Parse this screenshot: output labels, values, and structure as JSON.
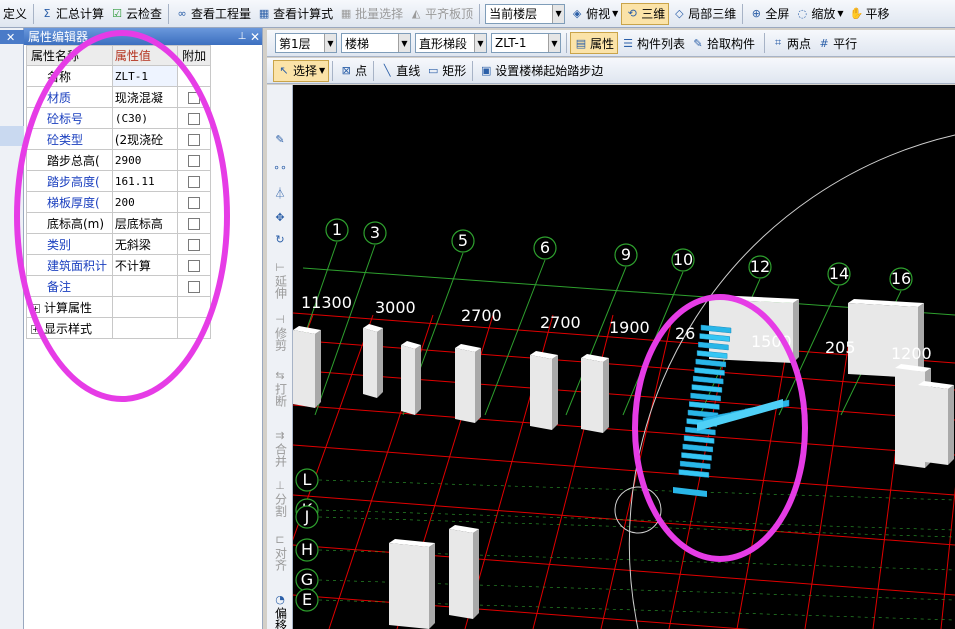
{
  "toolbar_top": {
    "define": "定义",
    "summary_calc": "汇总计算",
    "cloud_check": "云检查",
    "view_quantity": "查看工程量",
    "view_formula": "查看计算式",
    "batch_select": "批量选择",
    "flush_slab_top": "平齐板顶",
    "floor_select": "当前楼层",
    "top_view": "俯视",
    "three_d": "三维",
    "local_3d": "局部三维",
    "full_screen": "全屏",
    "zoom": "缩放",
    "pan": "平移"
  },
  "property_panel": {
    "title": "属性编辑器",
    "columns": [
      "属性名称",
      "属性值",
      "附加"
    ],
    "rows": [
      {
        "name": "名称",
        "value": "ZLT-1",
        "checkbox": false,
        "blue": false,
        "value_cjk": false
      },
      {
        "name": "材质",
        "value": "现浇混凝",
        "checkbox": true,
        "blue": true,
        "value_cjk": true
      },
      {
        "name": "砼标号",
        "value": "(C30)",
        "checkbox": true,
        "blue": true,
        "value_cjk": false
      },
      {
        "name": "砼类型",
        "value": "(2现浇砼",
        "checkbox": true,
        "blue": true,
        "value_cjk": true
      },
      {
        "name": "踏步总高(",
        "value": "2900",
        "checkbox": true,
        "blue": false,
        "value_cjk": false
      },
      {
        "name": "踏步高度(",
        "value": "161.11",
        "checkbox": true,
        "blue": true,
        "value_cjk": false
      },
      {
        "name": "梯板厚度(",
        "value": "200",
        "checkbox": true,
        "blue": true,
        "value_cjk": false
      },
      {
        "name": "底标高(m)",
        "value": "层底标高",
        "checkbox": true,
        "blue": false,
        "value_cjk": true
      },
      {
        "name": "类别",
        "value": "无斜梁",
        "checkbox": true,
        "blue": true,
        "value_cjk": true
      },
      {
        "name": "建筑面积计",
        "value": "不计算",
        "checkbox": true,
        "blue": true,
        "value_cjk": true
      },
      {
        "name": "备注",
        "value": "",
        "checkbox": true,
        "blue": true,
        "value_cjk": false
      }
    ],
    "groups": [
      "计算属性",
      "显示样式"
    ]
  },
  "toolbar_layer": {
    "floor": "第1层",
    "component_type": "楼梯",
    "stair_kind": "直形梯段",
    "component": "ZLT-1",
    "properties": "属性",
    "component_list": "构件列表",
    "pick_component": "拾取构件",
    "two_point": "两点",
    "parallel": "平行"
  },
  "toolbar_draw": {
    "select": "选择",
    "point": "点",
    "line": "直线",
    "rect": "矩形",
    "set_start_step": "设置楼梯起始踏步边"
  },
  "vertical_tools": [
    "延伸",
    "修剪",
    "打断",
    "合并",
    "分割",
    "对齐",
    "偏移"
  ],
  "viewport": {
    "grid_numbers": [
      "1",
      "3",
      "5",
      "6",
      "9",
      "10",
      "12",
      "14",
      "16"
    ],
    "grid_letters": [
      "L",
      "K",
      "J",
      "H",
      "G",
      "E"
    ],
    "dimensions": [
      "11300",
      "3000",
      "2700",
      "2700",
      "1900",
      "26",
      "1500",
      "205",
      "1200"
    ]
  },
  "colors": {
    "annotation": "#e63ce6",
    "grid_red": "#e00000",
    "grid_green": "#2ea02e",
    "stair_cyan": "#29b6e8"
  }
}
